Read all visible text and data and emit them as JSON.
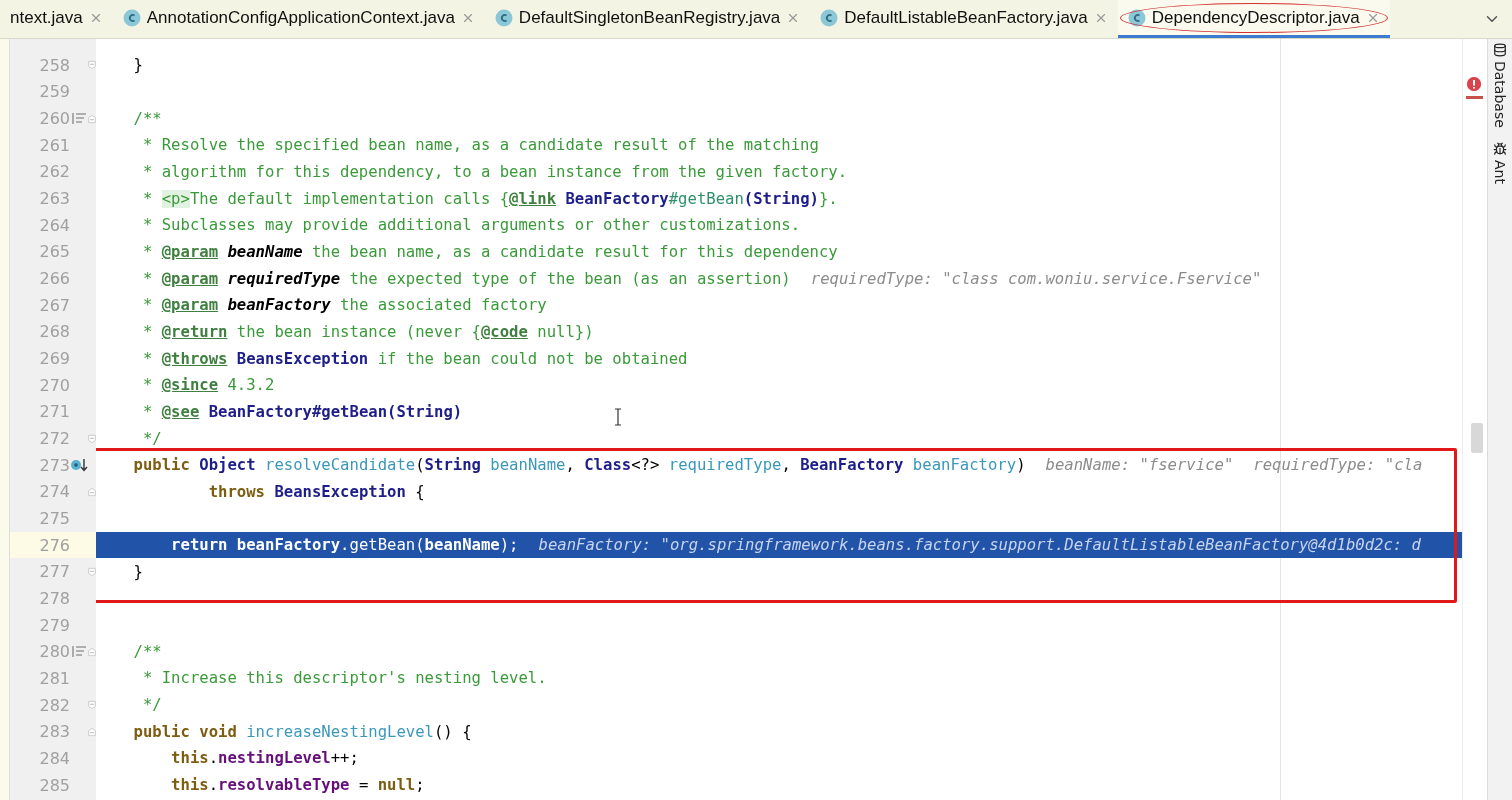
{
  "tabs": [
    {
      "label": "ntext.java",
      "selected": false,
      "circled": false,
      "kind": "plain"
    },
    {
      "label": "AnnotationConfigApplicationContext.java",
      "selected": false,
      "circled": false,
      "kind": "class"
    },
    {
      "label": "DefaultSingletonBeanRegistry.java",
      "selected": false,
      "circled": false,
      "kind": "class"
    },
    {
      "label": "DefaultListableBeanFactory.java",
      "selected": false,
      "circled": false,
      "kind": "class"
    },
    {
      "label": "DependencyDescriptor.java",
      "selected": true,
      "circled": true,
      "kind": "class"
    }
  ],
  "tool_windows": [
    {
      "label": "Database",
      "kind": "database"
    },
    {
      "label": "Ant",
      "kind": "ant"
    }
  ],
  "sections": [
    {
      "boxed": false,
      "lines": [
        {
          "number": "258",
          "kind": "fold-end",
          "current": false,
          "tokens": [
            {
              "kind": "plain",
              "text": "    }"
            }
          ]
        },
        {
          "number": "259",
          "kind": "plain",
          "current": false
        },
        {
          "number": "260",
          "kind": "doc-start",
          "current": false,
          "tokens": [
            {
              "kind": "doc",
              "text": "    /**"
            }
          ]
        },
        {
          "number": "261",
          "kind": "plain",
          "current": false,
          "tokens": [
            {
              "kind": "doc",
              "text": "     * Resolve the specified bean name, as a candidate result of the matching"
            }
          ]
        },
        {
          "number": "262",
          "kind": "plain",
          "current": false,
          "tokens": [
            {
              "kind": "doc",
              "text": "     * algorithm for this dependency, to a bean instance from the given factory."
            }
          ]
        },
        {
          "number": "263",
          "kind": "plain",
          "current": false,
          "tokens": [
            {
              "kind": "doc",
              "text": "     * "
            },
            {
              "kind": "html",
              "text": "<p>"
            },
            {
              "kind": "doc",
              "text": "The default implementation calls {"
            },
            {
              "kind": "doctag",
              "text": "@link"
            },
            {
              "kind": "type",
              "text": " BeanFactory"
            },
            {
              "kind": "ref",
              "text": "#getBean"
            },
            {
              "kind": "type",
              "text": "(String)"
            },
            {
              "kind": "doc",
              "text": "}."
            }
          ]
        },
        {
          "number": "264",
          "kind": "plain",
          "current": false,
          "tokens": [
            {
              "kind": "doc",
              "text": "     * Subclasses may provide additional arguments or other customizations."
            }
          ]
        },
        {
          "number": "265",
          "kind": "plain",
          "current": false,
          "tokens": [
            {
              "kind": "doc",
              "text": "     * "
            },
            {
              "kind": "doctag",
              "text": "@param"
            },
            {
              "kind": "docname",
              "text": " beanName"
            },
            {
              "kind": "doc",
              "text": " the bean name, as a candidate result for this dependency"
            }
          ]
        },
        {
          "number": "266",
          "kind": "plain",
          "current": false,
          "tokens": [
            {
              "kind": "doc",
              "text": "     * "
            },
            {
              "kind": "doctag",
              "text": "@param"
            },
            {
              "kind": "docname",
              "text": " requiredType"
            },
            {
              "kind": "doc",
              "text": " the expected type of the bean (as an assertion)"
            }
          ],
          "hints": [
            "requiredType: \"class com.woniu.service.Fservice\""
          ]
        },
        {
          "number": "267",
          "kind": "plain",
          "current": false,
          "tokens": [
            {
              "kind": "doc",
              "text": "     * "
            },
            {
              "kind": "doctag",
              "text": "@param"
            },
            {
              "kind": "docname",
              "text": " beanFactory"
            },
            {
              "kind": "doc",
              "text": " the associated factory"
            }
          ]
        },
        {
          "number": "268",
          "kind": "plain",
          "current": false,
          "tokens": [
            {
              "kind": "doc",
              "text": "     * "
            },
            {
              "kind": "doctag",
              "text": "@return"
            },
            {
              "kind": "doc",
              "text": " the bean instance (never {"
            },
            {
              "kind": "doctag",
              "text": "@code"
            },
            {
              "kind": "doc",
              "text": " null})"
            }
          ]
        },
        {
          "number": "269",
          "kind": "plain",
          "current": false,
          "tokens": [
            {
              "kind": "doc",
              "text": "     * "
            },
            {
              "kind": "doctag",
              "text": "@throws"
            },
            {
              "kind": "type",
              "text": " BeansException"
            },
            {
              "kind": "doc",
              "text": " if the bean could not be obtained"
            }
          ]
        },
        {
          "number": "270",
          "kind": "plain",
          "current": false,
          "tokens": [
            {
              "kind": "doc",
              "text": "     * "
            },
            {
              "kind": "doctag",
              "text": "@since"
            },
            {
              "kind": "doc",
              "text": " 4.3.2"
            }
          ]
        },
        {
          "number": "271",
          "kind": "plain",
          "current": false,
          "tokens": [
            {
              "kind": "doc",
              "text": "     * "
            },
            {
              "kind": "doctag",
              "text": "@see"
            },
            {
              "kind": "type",
              "text": " BeanFactory#getBean(String)"
            }
          ]
        },
        {
          "number": "272",
          "kind": "fold-end",
          "current": false,
          "tokens": [
            {
              "kind": "doc",
              "text": "     */"
            }
          ]
        }
      ]
    },
    {
      "boxed": true,
      "lines": [
        {
          "number": "273",
          "kind": "debug",
          "current": false,
          "tokens": [
            {
              "kind": "kw",
              "text": "    public"
            },
            {
              "kind": "type",
              "text": " Object"
            },
            {
              "kind": "decl",
              "text": " resolveCandidate"
            },
            {
              "kind": "plain",
              "text": "("
            },
            {
              "kind": "type",
              "text": "String"
            },
            {
              "kind": "param",
              "text": " beanName"
            },
            {
              "kind": "plain",
              "text": ", "
            },
            {
              "kind": "type",
              "text": "Class"
            },
            {
              "kind": "plain",
              "text": "<?> "
            },
            {
              "kind": "param",
              "text": "requiredType"
            },
            {
              "kind": "plain",
              "text": ", "
            },
            {
              "kind": "type",
              "text": "BeanFactory"
            },
            {
              "kind": "param",
              "text": " beanFactory"
            },
            {
              "kind": "plain",
              "text": ")"
            }
          ],
          "hints": [
            "beanName: \"fservice\"",
            "requiredType: \"cla"
          ]
        },
        {
          "number": "274",
          "kind": "fold-start",
          "current": false,
          "tokens": [
            {
              "kind": "kw",
              "text": "            throws"
            },
            {
              "kind": "type",
              "text": " BeansException"
            },
            {
              "kind": "plain",
              "text": " {"
            }
          ]
        },
        {
          "number": "275",
          "kind": "plain",
          "current": false
        },
        {
          "number": "276",
          "kind": "plain",
          "current": true,
          "tokens": [
            {
              "kind": "kw",
              "text": "        return"
            },
            {
              "kind": "bold",
              "text": " beanFactory"
            },
            {
              "kind": "plain",
              "text": ".getBean("
            },
            {
              "kind": "bold",
              "text": "beanName"
            },
            {
              "kind": "plain",
              "text": ");"
            }
          ],
          "hints": [
            "beanFactory: \"org.springframework.beans.factory.support.DefaultListableBeanFactory@4d1b0d2c: d"
          ]
        },
        {
          "number": "277",
          "kind": "fold-end",
          "current": false,
          "tokens": [
            {
              "kind": "plain",
              "text": "    }"
            }
          ]
        }
      ]
    },
    {
      "boxed": false,
      "lines": [
        {
          "number": "278",
          "kind": "plain",
          "current": false
        },
        {
          "number": "279",
          "kind": "plain",
          "current": false
        },
        {
          "number": "280",
          "kind": "doc-start",
          "current": false,
          "tokens": [
            {
              "kind": "doc",
              "text": "    /**"
            }
          ]
        },
        {
          "number": "281",
          "kind": "plain",
          "current": false,
          "tokens": [
            {
              "kind": "doc",
              "text": "     * Increase this descriptor's nesting level."
            }
          ]
        },
        {
          "number": "282",
          "kind": "fold-end",
          "current": false,
          "tokens": [
            {
              "kind": "doc",
              "text": "     */"
            }
          ]
        },
        {
          "number": "283",
          "kind": "fold-start",
          "current": false,
          "tokens": [
            {
              "kind": "kw",
              "text": "    public void"
            },
            {
              "kind": "decl",
              "text": " increaseNestingLevel"
            },
            {
              "kind": "plain",
              "text": "() {"
            }
          ]
        },
        {
          "number": "284",
          "kind": "plain",
          "current": false,
          "tokens": [
            {
              "kind": "kw",
              "text": "        this"
            },
            {
              "kind": "plain",
              "text": "."
            },
            {
              "kind": "field",
              "text": "nestingLevel"
            },
            {
              "kind": "plain",
              "text": "++;"
            }
          ]
        },
        {
          "number": "285",
          "kind": "plain",
          "current": false,
          "tokens": [
            {
              "kind": "kw",
              "text": "        this"
            },
            {
              "kind": "plain",
              "text": "."
            },
            {
              "kind": "field",
              "text": "resolvableType"
            },
            {
              "kind": "plain",
              "text": " = "
            },
            {
              "kind": "kw",
              "text": "null"
            },
            {
              "kind": "plain",
              "text": ";"
            }
          ]
        }
      ]
    }
  ]
}
